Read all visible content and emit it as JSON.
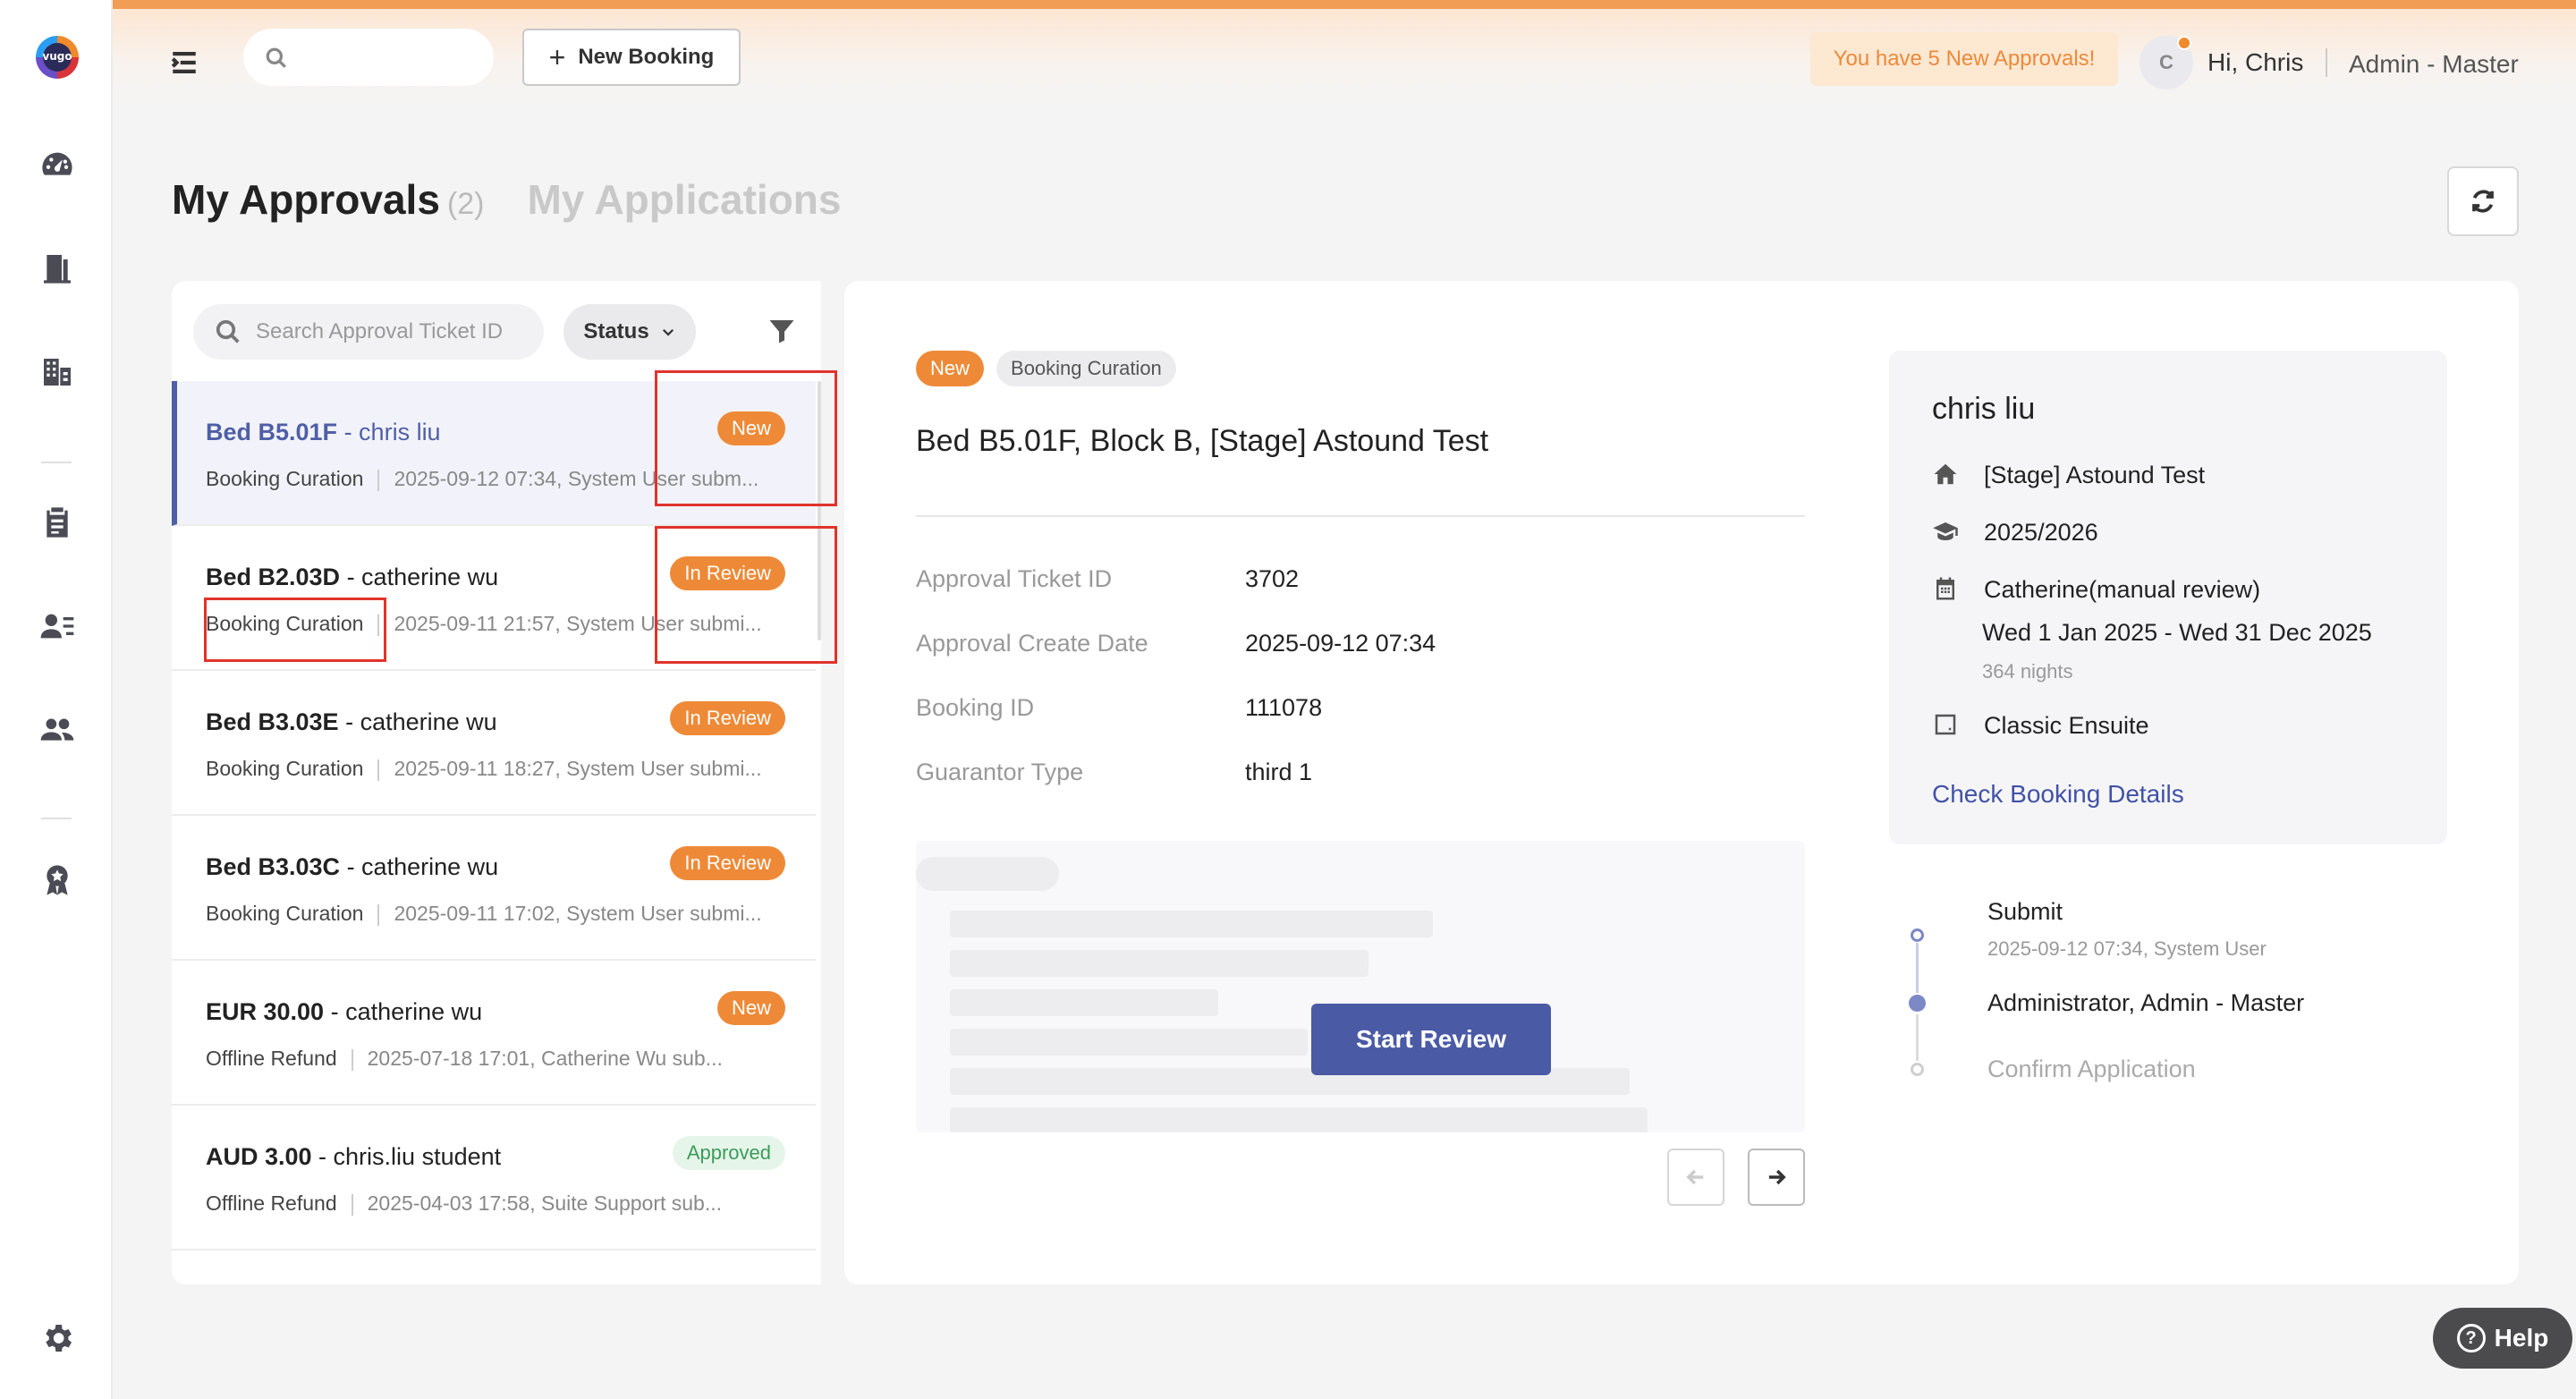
{
  "app": {
    "logo_text": "vugo"
  },
  "topbar": {
    "search_placeholder": "",
    "new_booking_label": "New Booking",
    "approvals_alert": "You have 5 New Approvals!",
    "avatar_initial": "C",
    "greeting": "Hi, Chris",
    "role": "Admin - Master"
  },
  "page": {
    "tab_approvals": "My Approvals",
    "tab_approvals_count": "(2)",
    "tab_applications": "My Applications"
  },
  "list": {
    "search_placeholder": "Search Approval Ticket ID",
    "status_filter": "Status",
    "rows": [
      {
        "title_bold": "Bed B5.01F",
        "title_rest": " - chris liu",
        "type": "Booking Curation",
        "sub": "2025-09-12 07:34, System User subm...",
        "badge": "New"
      },
      {
        "title_bold": "Bed B2.03D",
        "title_rest": " - catherine wu",
        "type": "Booking Curation",
        "sub": "2025-09-11 21:57, System User submi...",
        "badge": "In Review"
      },
      {
        "title_bold": "Bed B3.03E",
        "title_rest": " - catherine wu",
        "type": "Booking Curation",
        "sub": "2025-09-11 18:27, System User submi...",
        "badge": "In Review"
      },
      {
        "title_bold": "Bed B3.03C",
        "title_rest": " - catherine wu",
        "type": "Booking Curation",
        "sub": "2025-09-11 17:02, System User submi...",
        "badge": "In Review"
      },
      {
        "title_bold": "EUR 30.00",
        "title_rest": " - catherine wu",
        "type": "Offline Refund",
        "sub": "2025-07-18 17:01, Catherine Wu sub...",
        "badge": "New"
      },
      {
        "title_bold": "AUD 3.00",
        "title_rest": " - chris.liu student",
        "type": "Offline Refund",
        "sub": "2025-04-03 17:58, Suite Support sub...",
        "badge": "Approved"
      }
    ]
  },
  "detail": {
    "badge_status": "New",
    "badge_type": "Booking Curation",
    "title": "Bed B5.01F, Block B, [Stage] Astound Test",
    "fields": [
      {
        "label": "Approval Ticket ID",
        "value": "3702"
      },
      {
        "label": "Approval Create Date",
        "value": "2025-09-12 07:34"
      },
      {
        "label": "Booking ID",
        "value": "111078"
      },
      {
        "label": "Guarantor Type",
        "value": "third 1"
      }
    ],
    "start_review_label": "Start Review"
  },
  "info_card": {
    "name": "chris liu",
    "property": "[Stage] Astound Test",
    "year": "2025/2026",
    "contract": "Catherine(manual review)",
    "dates": "Wed 1 Jan 2025 - Wed 31 Dec 2025",
    "nights": "364 nights",
    "room_type": "Classic Ensuite",
    "link": "Check Booking Details"
  },
  "timeline": {
    "steps": [
      {
        "label": "Submit",
        "meta": "2025-09-12 07:34, System User"
      },
      {
        "label": "Administrator, Admin - Master",
        "meta": ""
      },
      {
        "label": "Confirm Application",
        "meta": ""
      }
    ]
  },
  "help_label": "Help"
}
